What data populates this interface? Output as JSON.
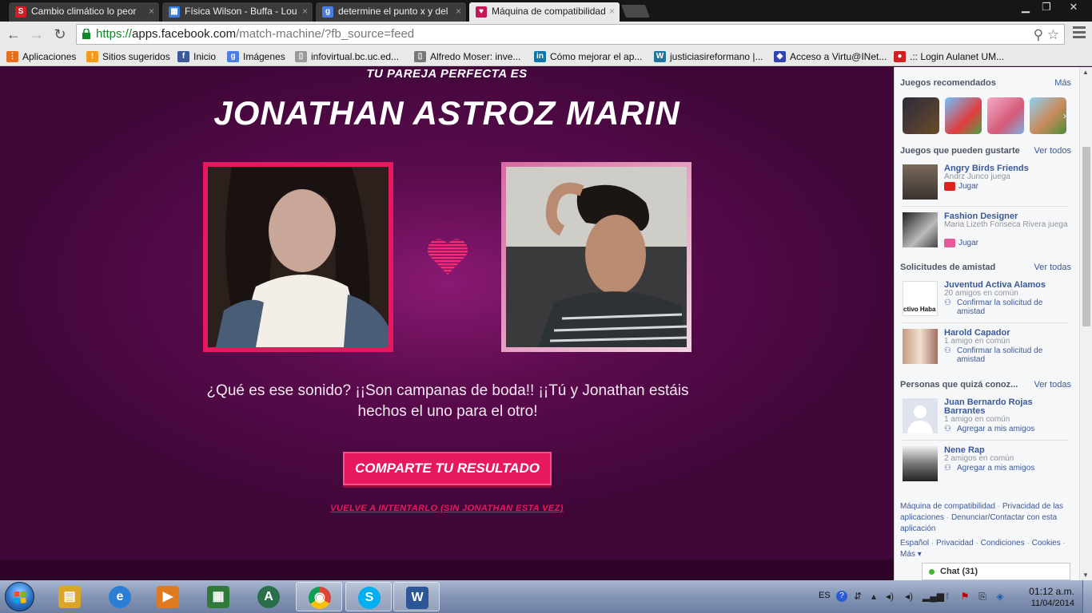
{
  "browser": {
    "tabs": [
      {
        "title": "Cambio climático lo peor",
        "icon": "scribd-icon",
        "color": "#d21f26",
        "glyph": "S"
      },
      {
        "title": "Física Wilson - Buffa - Lou",
        "icon": "blogger-icon",
        "color": "#3a7fd9",
        "glyph": "▦"
      },
      {
        "title": "determine el punto x y del",
        "icon": "google-icon",
        "color": "#4a7ee3",
        "glyph": "g"
      },
      {
        "title": "Máquina de compatibilidad",
        "icon": "heart-app-icon",
        "color": "#c2185b",
        "glyph": "♥"
      }
    ],
    "url": {
      "scheme": "https://",
      "host": "apps.facebook.com",
      "path": "/match-machine/?fb_source=feed"
    },
    "bookmarks": [
      {
        "label": "Aplicaciones",
        "icon": "apps-grid-icon",
        "color": "#e46f1c",
        "glyph": "⋮"
      },
      {
        "label": "Sitios sugeridos",
        "icon": "suggested-sites-icon",
        "color": "#f29a1b",
        "glyph": "!"
      },
      {
        "label": "Inicio",
        "icon": "facebook-icon",
        "color": "#3b5998",
        "glyph": "f"
      },
      {
        "label": "Imágenes",
        "icon": "google-icon",
        "color": "#4a7ee3",
        "glyph": "g"
      },
      {
        "label": "infovirtual.bc.uc.ed...",
        "icon": "page-icon",
        "color": "#999999",
        "glyph": "▯"
      },
      {
        "label": "Alfredo Moser: inve...",
        "icon": "page-icon",
        "color": "#777777",
        "glyph": "▯"
      },
      {
        "label": "Cómo mejorar el ap...",
        "icon": "linkedin-icon",
        "color": "#0e76a8",
        "glyph": "in"
      },
      {
        "label": "justiciasireformano |...",
        "icon": "wordpress-icon",
        "color": "#21759b",
        "glyph": "W"
      },
      {
        "label": "Acceso a Virtu@INet...",
        "icon": "virtual-icon",
        "color": "#3344aa",
        "glyph": "◆"
      },
      {
        "label": ".:: Login Aulanet UM...",
        "icon": "aulanet-icon",
        "color": "#cc2222",
        "glyph": "●"
      }
    ]
  },
  "match": {
    "subtitle": "TU PAREJA PERFECTA ES",
    "name": "JONATHAN ASTROZ MARIN",
    "message": "¿Qué es ese sonido? ¡¡Son campanas de boda!! ¡¡Tú y Jonathan estáis hechos el uno para el otro!",
    "share_label": "COMPARTE TU RESULTADO",
    "retry_label": "VUELVE A INTENTARLO (SIN JONATHAN ESTA VEZ)",
    "accent": "#e8185e"
  },
  "sidebar": {
    "recommended": {
      "title": "Juegos recomendados",
      "more": "Más"
    },
    "games_liked": {
      "title": "Juegos que pueden gustarte",
      "more": "Ver todos",
      "items": [
        {
          "name": "Angry Birds Friends",
          "sub": "Andrz Junco juega",
          "action": "Jugar"
        },
        {
          "name": "Fashion Designer",
          "sub": "Maria Lizeth Fonseca Rivera juega",
          "action": "Jugar"
        }
      ]
    },
    "friend_requests": {
      "title": "Solicitudes de amistad",
      "more": "Ver todas",
      "items": [
        {
          "name": "Juventud Activa Alamos",
          "sub": "20 amigos en común",
          "action": "Confirmar la solicitud de amistad",
          "avatar_text": "ctivo Haba"
        },
        {
          "name": "Harold Capador",
          "sub": "1 amigo en común",
          "action": "Confirmar la solicitud de amistad"
        }
      ]
    },
    "people": {
      "title": "Personas que quizá conoz...",
      "more": "Ver todas",
      "items": [
        {
          "name": "Juan Bernardo Rojas Barrantes",
          "sub": "1 amigo en común",
          "action": "Agregar a mis amigos"
        },
        {
          "name": "Nene Rap",
          "sub": "2 amigos en común",
          "action": "Agregar a mis amigos"
        }
      ]
    },
    "footer": {
      "app_link": "Máquina de compatibilidad",
      "privacy_apps": "Privacidad de las aplicaciones",
      "report": "Denunciar/Contactar con esta aplicación",
      "lang": "Español",
      "privacy": "Privacidad",
      "terms": "Condiciones",
      "cookies": "Cookies",
      "more": "Más",
      "sep": "·",
      "caret": "▾"
    },
    "chat": "Chat (31)"
  },
  "taskbar": {
    "lang": "ES",
    "time": "01:12 a.m.",
    "date": "11/04/2014",
    "apps": [
      {
        "name": "explorer",
        "icon": "folder-icon",
        "color": "#d9a62a",
        "glyph": "▤",
        "open": false
      },
      {
        "name": "ie",
        "icon": "internet-explorer-icon",
        "color": "#2a7fd4",
        "glyph": "e",
        "open": false
      },
      {
        "name": "media",
        "icon": "media-player-icon",
        "color": "#e07a20",
        "glyph": "▶",
        "open": false
      },
      {
        "name": "excel",
        "icon": "spreadsheet-icon",
        "color": "#2f7a3a",
        "glyph": "▦",
        "open": false
      },
      {
        "name": "atlas",
        "icon": "atlas-icon",
        "color": "#2a6f4a",
        "glyph": "A",
        "open": false
      },
      {
        "name": "chrome",
        "icon": "chrome-icon",
        "color": "#d93a2b",
        "glyph": "◉",
        "open": true
      },
      {
        "name": "skype",
        "icon": "skype-icon",
        "color": "#00aff0",
        "glyph": "S",
        "open": true
      },
      {
        "name": "word",
        "icon": "word-icon",
        "color": "#2b5797",
        "glyph": "W",
        "open": true
      }
    ]
  }
}
